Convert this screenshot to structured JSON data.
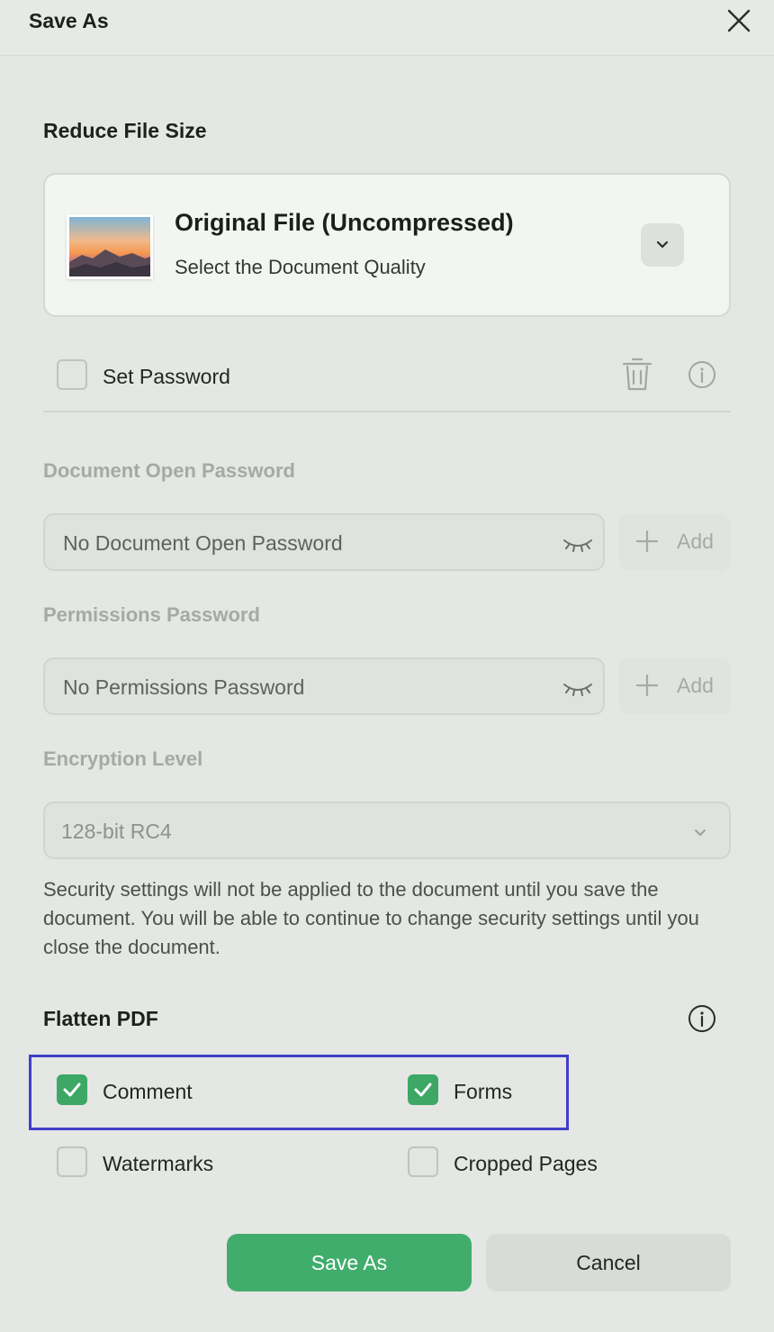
{
  "dialog": {
    "title": "Save As",
    "close_icon": "close-icon"
  },
  "reduce": {
    "heading": "Reduce File Size",
    "card_title": "Original File (Uncompressed)",
    "card_subtitle": "Select the Document Quality",
    "dropdown_icon": "chevron-down-icon"
  },
  "password": {
    "set_label": "Set Password",
    "set_checked": false,
    "delete_icon": "trash-icon",
    "info_icon": "info-icon",
    "open_label": "Document Open Password",
    "open_value": "No Document Open Password",
    "permissions_label": "Permissions Password",
    "permissions_value": "No Permissions Password",
    "add_label": "Add",
    "encryption_label": "Encryption Level",
    "encryption_value": "128-bit RC4",
    "note": "Security settings will not be applied to the document until you save the document. You will be able to continue to change security settings until you close the document."
  },
  "flatten": {
    "heading": "Flatten PDF",
    "info_icon": "info-icon",
    "options": [
      {
        "label": "Comment",
        "checked": true
      },
      {
        "label": "Forms",
        "checked": true
      },
      {
        "label": "Watermarks",
        "checked": false
      },
      {
        "label": "Cropped Pages",
        "checked": false
      }
    ]
  },
  "footer": {
    "save_label": "Save As",
    "cancel_label": "Cancel"
  },
  "colors": {
    "accent": "#41ad6c",
    "highlight": "#3f3fc9",
    "background": "#e4e7e3"
  }
}
